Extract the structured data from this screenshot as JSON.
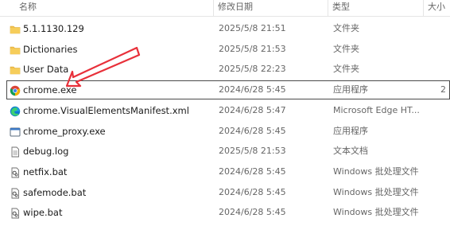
{
  "columns": {
    "name": "名称",
    "date": "修改日期",
    "type": "类型",
    "size": "大小"
  },
  "rows": [
    {
      "name": "5.1.1130.129",
      "date": "2025/5/8 21:51",
      "type": "文件夹",
      "icon": "folder-icon"
    },
    {
      "name": "Dictionaries",
      "date": "2025/5/8 21:53",
      "type": "文件夹",
      "icon": "folder-icon"
    },
    {
      "name": "User Data",
      "date": "2025/5/8 22:23",
      "type": "文件夹",
      "icon": "folder-icon"
    },
    {
      "name": "chrome.exe",
      "date": "2024/6/28 5:45",
      "type": "应用程序",
      "icon": "chrome-icon",
      "selected": true
    },
    {
      "name": "chrome.VisualElementsManifest.xml",
      "date": "2024/6/28 5:47",
      "type": "Microsoft Edge HT...",
      "icon": "edge-icon"
    },
    {
      "name": "chrome_proxy.exe",
      "date": "2024/6/28 5:45",
      "type": "应用程序",
      "icon": "application-icon"
    },
    {
      "name": "debug.log",
      "date": "2025/5/8 21:53",
      "type": "文本文档",
      "icon": "text-file-icon"
    },
    {
      "name": "netfix.bat",
      "date": "2024/6/28 5:45",
      "type": "Windows 批处理文件",
      "icon": "batch-file-icon"
    },
    {
      "name": "safemode.bat",
      "date": "2024/6/28 5:45",
      "type": "Windows 批处理文件",
      "icon": "batch-file-icon"
    },
    {
      "name": "wipe.bat",
      "date": "2024/6/28 5:45",
      "type": "Windows 批处理文件",
      "icon": "batch-file-icon"
    }
  ],
  "size_peek": "2",
  "colors": {
    "folder": "#f2c14e",
    "arrow": "#e8303a",
    "selection_border": "#4a4a4a",
    "header_text": "#666666"
  }
}
